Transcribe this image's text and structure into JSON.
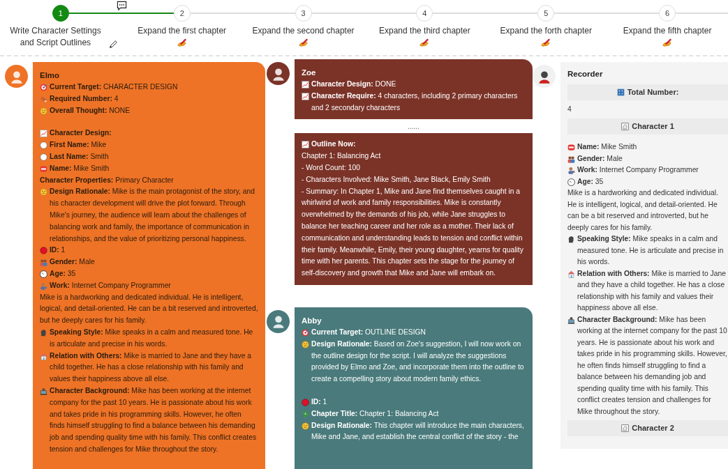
{
  "steps": [
    {
      "number": "1",
      "label": "Write Character Settings and Script Outlines",
      "done": true
    },
    {
      "number": "2",
      "label": "Expand the first chapter",
      "done": false
    },
    {
      "number": "3",
      "label": "Expand the second chapter",
      "done": false
    },
    {
      "number": "4",
      "label": "Expand the third chapter",
      "done": false
    },
    {
      "number": "5",
      "label": "Expand the forth chapter",
      "done": false
    },
    {
      "number": "6",
      "label": "Expand the fifth chapter",
      "done": false
    }
  ],
  "messages": [
    {
      "sender": "Elmo",
      "color": "#ee7326",
      "blocks": [
        {
          "sections": [
            [
              {
                "kind": "target",
                "label": "Current Target:",
                "value": "CHARACTER DESIGN"
              },
              {
                "kind": "count",
                "label": "Required Number:",
                "value": "4"
              },
              {
                "kind": "thought",
                "label": "Overall Thought:",
                "value": "NONE"
              }
            ],
            [
              {
                "kind": "chart",
                "label": "Character Design:"
              },
              {
                "kind": "white-dot",
                "label": "First Name:",
                "value": "Mike"
              },
              {
                "kind": "white-dot",
                "label": "Last Name:",
                "value": "Smith"
              },
              {
                "kind": "badge",
                "label": "Name:",
                "value": "Mike Smith"
              },
              {
                "kind": "plain",
                "label": "Character Properties:",
                "value": "Primary Character"
              },
              {
                "kind": "thought",
                "label": "Design Rationale:",
                "value": "Mike is the main protagonist of the story, and his character development will drive the plot forward. Through Mike's journey, the audience will learn about the challenges of balancing work and family, the importance of communication in relationships, and the value of prioritizing personal happiness."
              },
              {
                "kind": "red-dot",
                "label": "ID:",
                "value": "1"
              },
              {
                "kind": "people",
                "label": "Gender:",
                "value": "Male"
              },
              {
                "kind": "clock",
                "label": "Age:",
                "value": "35"
              },
              {
                "kind": "person",
                "label": "Work:",
                "value": "Internet Company Programmer"
              },
              {
                "kind": "plain",
                "value": "Mike is a hardworking and dedicated individual. He is intelligent, logical, and detail-oriented. He can be a bit reserved and introverted, but he deeply cares for his family."
              },
              {
                "kind": "speaker",
                "label": "Speaking Style:",
                "value": "Mike speaks in a calm and measured tone. He is articulate and precise in his words."
              },
              {
                "kind": "house",
                "label": "Relation with Others:",
                "value": "Mike is married to Jane and they have a child together. He has a close relationship with his family and values their happiness above all else."
              },
              {
                "kind": "desk",
                "label": "Character Background:",
                "value": "Mike has been working at the internet company for the past 10 years. He is passionate about his work and takes pride in his programming skills. However, he often finds himself struggling to find a balance between his demanding job and spending quality time with his family. This conflict creates tension and challenges for Mike throughout the story."
              }
            ]
          ]
        }
      ]
    },
    {
      "sender": "Zoe",
      "color": "#7b3328",
      "separator": "......",
      "blocks": [
        {
          "sections": [
            [
              {
                "kind": "chart",
                "label": "Character Design:",
                "value": "DONE"
              },
              {
                "kind": "chart",
                "label": "Character Require:",
                "value": "4 characters, including 2 primary characters and 2 secondary characters"
              }
            ]
          ]
        },
        {
          "sections": [
            [
              {
                "kind": "chart",
                "label": "Outline Now:"
              },
              {
                "kind": "plain",
                "value": "Chapter 1: Balancing Act"
              },
              {
                "kind": "plain",
                "value": "- Word Count: 100"
              },
              {
                "kind": "plain",
                "value": "- Characters Involved: Mike Smith, Jane Black, Emily Smith"
              },
              {
                "kind": "plain",
                "value": "- Summary: In Chapter 1, Mike and Jane find themselves caught in a whirlwind of work and family responsibilities. Mike is constantly overwhelmed by the demands of his job, while Jane struggles to balance her teaching career and her role as a mother. Their lack of communication and understanding leads to tension and conflict within their family. Meanwhile, Emily, their young daughter, yearns for quality time with her parents. This chapter sets the stage for the journey of self-discovery and growth that Mike and Jane will embark on."
              }
            ]
          ]
        }
      ]
    },
    {
      "sender": "Abby",
      "color": "#4a7a7b",
      "blocks": [
        {
          "sections": [
            [
              {
                "kind": "target",
                "label": "Current Target:",
                "value": "OUTLINE DESIGN"
              },
              {
                "kind": "thought",
                "label": "Design Rationale:",
                "value": "Based on Zoe's suggestion, I will now work on the outline design for the script. I will analyze the suggestions provided by Elmo and Zoe, and incorporate them into the outline to create a compelling story about modern family ethics."
              }
            ],
            [
              {
                "kind": "red-dot",
                "label": "ID:",
                "value": "1"
              },
              {
                "kind": "puzzle",
                "label": "Chapter Title:",
                "value": "Chapter 1: Balancing Act"
              },
              {
                "kind": "thought",
                "label": "Design Rationale:",
                "value": "This chapter will introduce the main characters, Mike and Jane, and establish the central conflict of the story - the"
              }
            ]
          ]
        }
      ]
    }
  ],
  "recorder": {
    "sender": "Recorder",
    "rows": [
      {
        "kind": "grid",
        "label": "Total Number:"
      },
      {
        "kind": "value",
        "value": "4"
      },
      {
        "kind": "portrait",
        "label": "Character 1"
      },
      {
        "kind": "badge",
        "label": "Name:",
        "value": "Mike Smith"
      },
      {
        "kind": "people",
        "label": "Gender:",
        "value": "Male"
      },
      {
        "kind": "person",
        "label": "Work:",
        "value": "Internet Company Programmer"
      },
      {
        "kind": "clock",
        "label": "Age:",
        "value": "35"
      },
      {
        "kind": "plain",
        "value": "Mike is a hardworking and dedicated individual. He is intelligent, logical, and detail-oriented. He can be a bit reserved and introverted, but he deeply cares for his family."
      },
      {
        "kind": "speaker",
        "label": "Speaking Style:",
        "value": "Mike speaks in a calm and measured tone. He is articulate and precise in his words."
      },
      {
        "kind": "house",
        "label": "Relation with Others:",
        "value": "Mike is married to Jane and they have a child together. He has a close relationship with his family and values their happiness above all else."
      },
      {
        "kind": "desk",
        "label": "Character Background:",
        "value": "Mike has been working at the internet company for the past 10 years. He is passionate about his work and takes pride in his programming skills. However, he often finds himself struggling to find a balance between his demanding job and spending quality time with his family. This conflict creates tension and challenges for Mike throughout the story."
      },
      {
        "kind": "portrait",
        "label": "Character 2"
      }
    ]
  }
}
